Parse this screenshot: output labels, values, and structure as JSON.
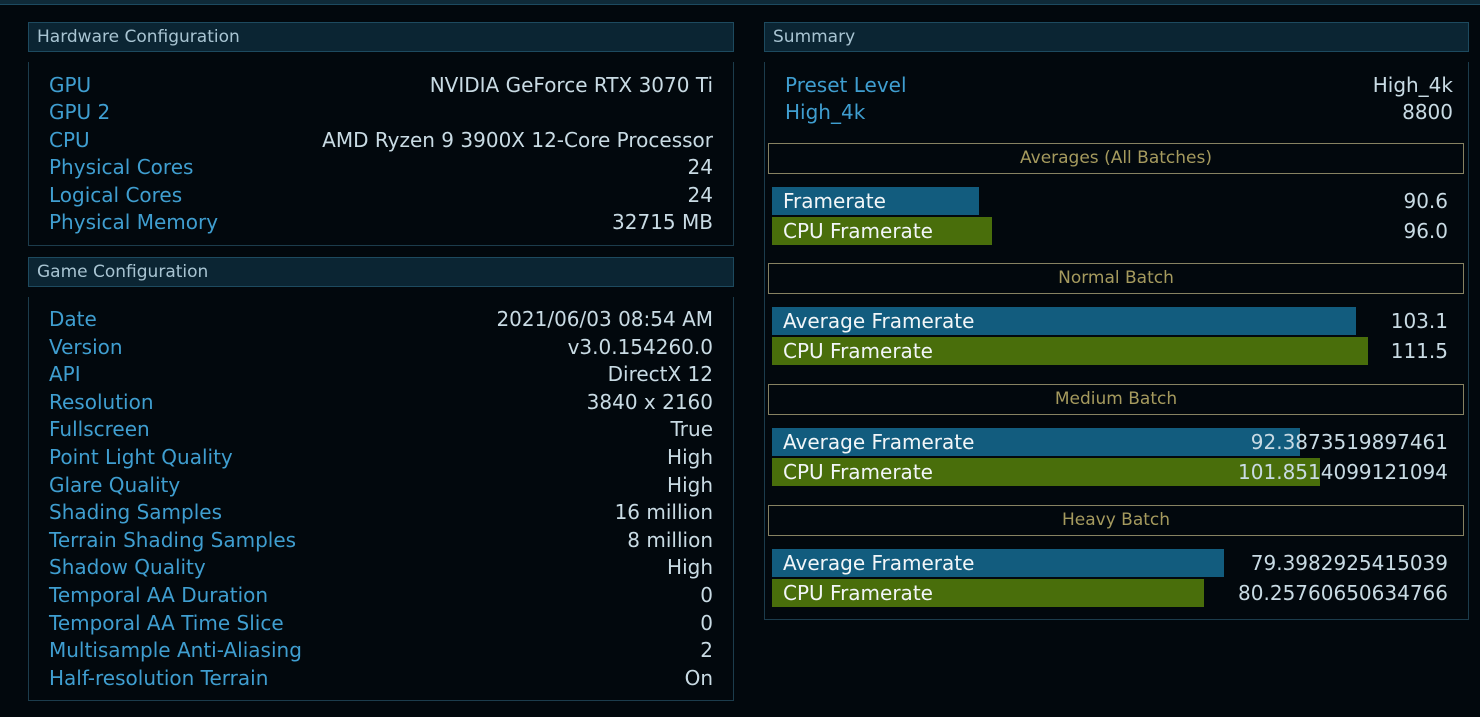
{
  "hardware": {
    "title": "Hardware Configuration",
    "rows": [
      {
        "label": "GPU",
        "value": "NVIDIA GeForce RTX 3070 Ti"
      },
      {
        "label": "GPU 2",
        "value": ""
      },
      {
        "label": "CPU",
        "value": "AMD Ryzen 9 3900X 12-Core Processor"
      },
      {
        "label": "Physical Cores",
        "value": "24"
      },
      {
        "label": "Logical Cores",
        "value": "24"
      },
      {
        "label": "Physical Memory",
        "value": "32715 MB"
      }
    ]
  },
  "game": {
    "title": "Game Configuration",
    "rows": [
      {
        "label": "Date",
        "value": "2021/06/03 08:54 AM"
      },
      {
        "label": "Version",
        "value": "v3.0.154260.0"
      },
      {
        "label": "API",
        "value": "DirectX 12"
      },
      {
        "label": "Resolution",
        "value": "3840 x 2160"
      },
      {
        "label": "Fullscreen",
        "value": "True"
      },
      {
        "label": "Point Light Quality",
        "value": "High"
      },
      {
        "label": "Glare Quality",
        "value": "High"
      },
      {
        "label": "Shading Samples",
        "value": "16 million"
      },
      {
        "label": "Terrain Shading Samples",
        "value": "8 million"
      },
      {
        "label": "Shadow Quality",
        "value": "High"
      },
      {
        "label": "Temporal AA Duration",
        "value": "0"
      },
      {
        "label": "Temporal AA Time Slice",
        "value": "0"
      },
      {
        "label": "Multisample Anti-Aliasing",
        "value": "2"
      },
      {
        "label": "Half-resolution Terrain",
        "value": "On"
      }
    ]
  },
  "summary": {
    "title": "Summary",
    "rows": [
      {
        "label": "Preset Level",
        "value": "High_4k"
      },
      {
        "label": "High_4k",
        "value": "8800"
      }
    ],
    "sections": [
      {
        "title": "Averages (All Batches)",
        "bars": [
          {
            "label": "Framerate",
            "value": "90.6",
            "fill": 0.304,
            "color": "blue"
          },
          {
            "label": "CPU Framerate",
            "value": "96.0",
            "fill": 0.323,
            "color": "green"
          }
        ]
      },
      {
        "title": "Normal Batch",
        "bars": [
          {
            "label": "Average Framerate",
            "value": "103.1",
            "fill": 0.859,
            "color": "blue"
          },
          {
            "label": "CPU Framerate",
            "value": "111.5",
            "fill": 0.877,
            "color": "green"
          }
        ]
      },
      {
        "title": "Medium Batch",
        "bars": [
          {
            "label": "Average Framerate",
            "value": "92.3873519897461",
            "fill": 0.776,
            "color": "blue"
          },
          {
            "label": "CPU Framerate",
            "value": "101.8514099121094",
            "fill": 0.806,
            "color": "green"
          }
        ]
      },
      {
        "title": "Heavy Batch",
        "bars": [
          {
            "label": "Average Framerate",
            "value": "79.3982925415039",
            "fill": 0.665,
            "color": "blue"
          },
          {
            "label": "CPU Framerate",
            "value": "80.25760650634766",
            "fill": 0.635,
            "color": "green"
          }
        ]
      }
    ]
  },
  "colors": {
    "bar_blue": "#125c7e",
    "bar_green": "#496e0b",
    "label": "#3f9ed0",
    "section": "#a59a5e"
  }
}
